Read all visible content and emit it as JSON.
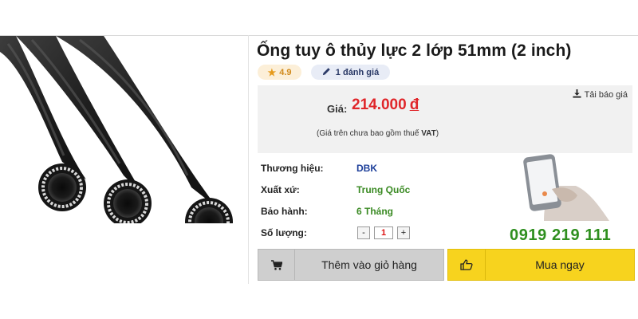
{
  "product": {
    "title": "Ống tuy ô thủy lực 2 lớp 51mm (2 inch)",
    "rating": "4.9",
    "reviews": "1 đánh giá"
  },
  "price": {
    "report_label": "Tải báo giá",
    "label": "Giá:",
    "amount": "214.000",
    "currency": "đ",
    "note_prefix": "(Giá trên chưa bao gồm thuế ",
    "note_vat": "VAT",
    "note_suffix": ")"
  },
  "specs": [
    {
      "label": "Thương hiệu:",
      "value": "DBK"
    },
    {
      "label": "Xuất xứ:",
      "value": "Trung Quốc"
    },
    {
      "label": "Bảo hành:",
      "value": "6 Tháng"
    },
    {
      "label": "Số lượng:"
    }
  ],
  "quantity": {
    "minus": "-",
    "value": "1",
    "plus": "+"
  },
  "hotline": "0919 219 111",
  "actions": {
    "add_to_cart": "Thêm vào giỏ hàng",
    "buy_now": "Mua ngay"
  },
  "icons": {
    "star": "star-icon",
    "pencil": "pencil-icon",
    "download": "download-icon",
    "cart": "cart-icon",
    "thumbs_up": "thumbs-up-icon"
  },
  "colors": {
    "price": "#e0262a",
    "brand_value": "#1d3f9a",
    "green_value": "#3a8a23",
    "buy_button": "#f7d31e",
    "cart_button": "#cfcfcf"
  }
}
